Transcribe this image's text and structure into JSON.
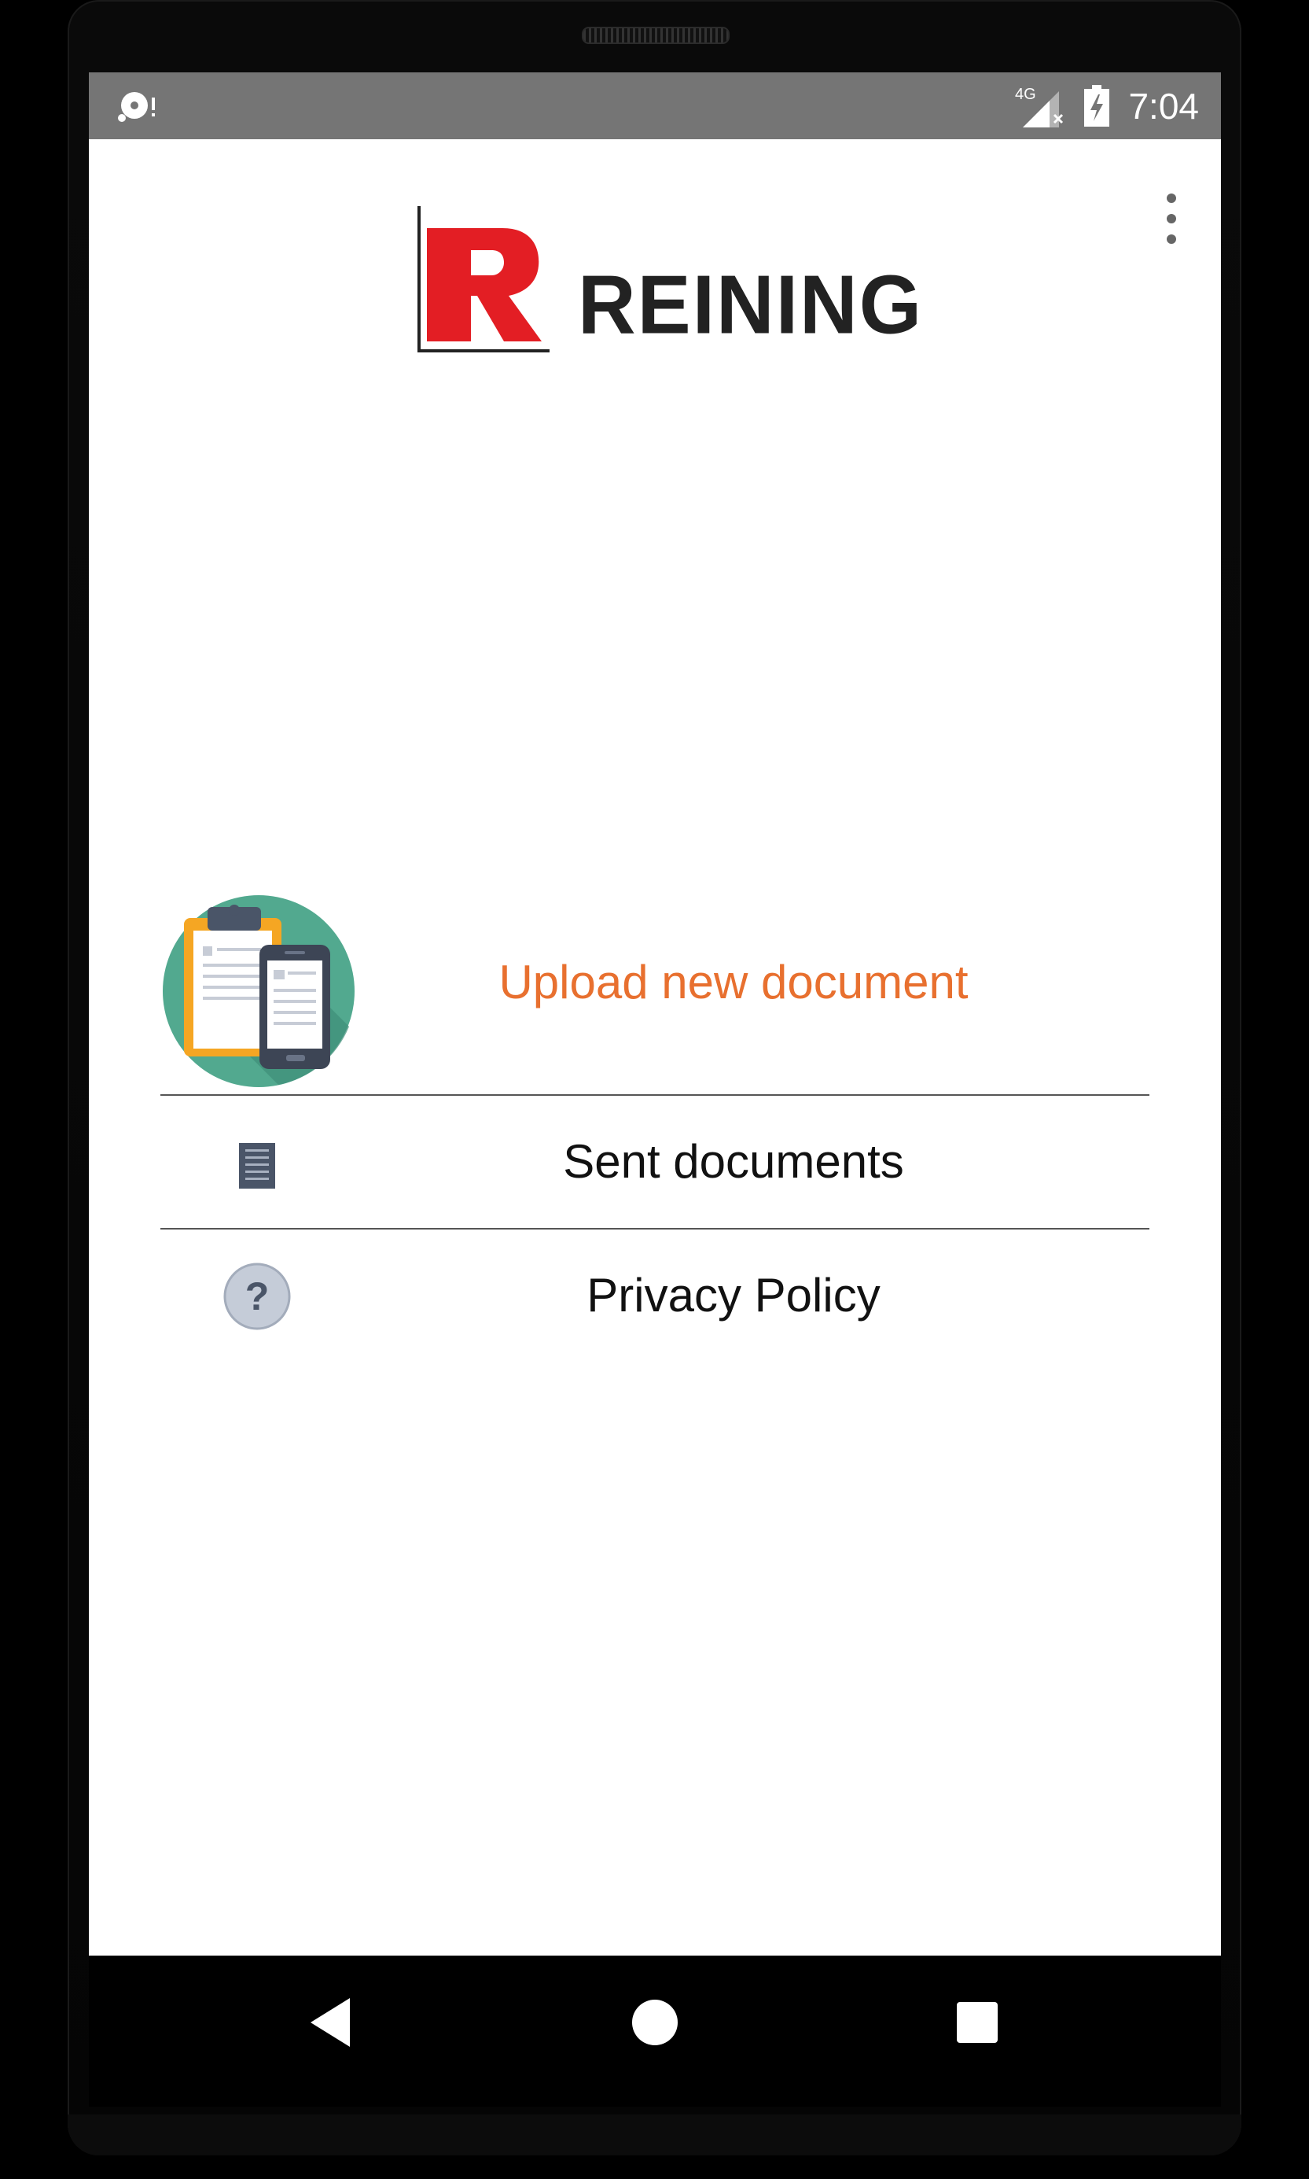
{
  "status_bar": {
    "time": "7:04",
    "network": "4G",
    "icons": [
      "sync-alert-icon",
      "signal-4g-icon",
      "battery-charging-icon"
    ]
  },
  "app": {
    "logo_text": "REINING",
    "menu_icon": "overflow-menu-icon",
    "brand_red": "#e31e24",
    "accent_orange": "#e8702f"
  },
  "menu": {
    "upload": {
      "label": "Upload new document",
      "icon": "clipboard-phone-icon"
    },
    "sent": {
      "label": "Sent documents",
      "icon": "document-icon"
    },
    "privacy": {
      "label": "Privacy Policy",
      "icon": "help-circle-icon"
    }
  },
  "nav_bar": {
    "buttons": [
      "back-icon",
      "home-icon",
      "recents-icon"
    ]
  }
}
